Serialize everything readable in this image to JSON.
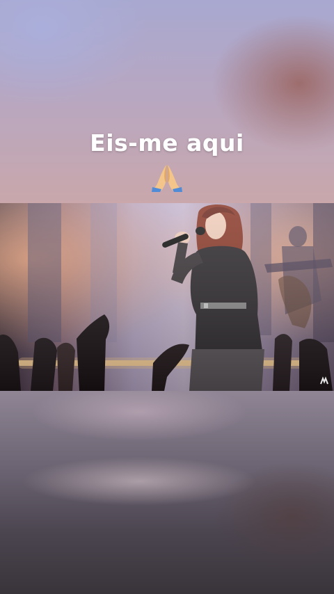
{
  "story": {
    "caption": "Eis-me aqui",
    "emoji_name": "folded-hands-emoji"
  },
  "video": {
    "scene": "singer-on-stage",
    "watermark_icon": "channel-logo-icon"
  },
  "colors": {
    "caption_text": "#ffffff",
    "stage_light": "#ffd9a0",
    "backdrop_top": "#b7a7c2",
    "backdrop_bottom": "#4b4550"
  }
}
